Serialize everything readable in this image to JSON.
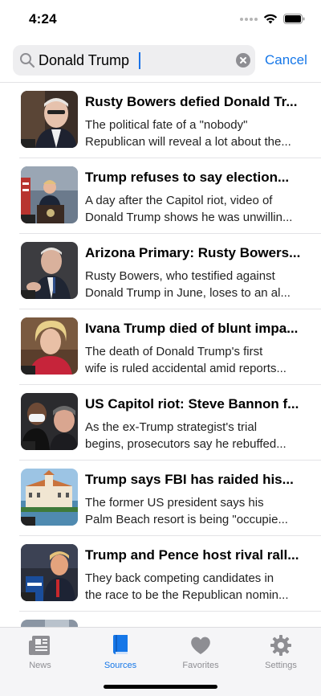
{
  "status": {
    "time": "4:24"
  },
  "search": {
    "query": "Donald Trump",
    "cancel_label": "Cancel"
  },
  "articles": [
    {
      "title": "Rusty Bowers defied Donald Tr...",
      "desc1": "The political fate of a \"nobody\"",
      "desc2": "Republican will reveal a lot about the...",
      "thumb": "man-glasses-portrait"
    },
    {
      "title": " Trump refuses to say election...",
      "desc1": "A day after the Capitol riot, video of",
      "desc2": "Donald Trump shows he was unwillin...",
      "thumb": "podium-press-room"
    },
    {
      "title": "Arizona Primary: Rusty Bowers...",
      "desc1": "Rusty Bowers, who testified against",
      "desc2": "Donald Trump in June, loses to an al...",
      "thumb": "man-testifying"
    },
    {
      "title": "Ivana Trump died of blunt impa...",
      "desc1": "The death of Donald Trump's first",
      "desc2": "wife is ruled accidental amid reports...",
      "thumb": "woman-portrait"
    },
    {
      "title": "US Capitol riot: Steve Bannon f...",
      "desc1": "As the ex-Trump strategist's trial",
      "desc2": "begins, prosecutors say he rebuffed...",
      "thumb": "men-with-mask"
    },
    {
      "title": " Trump says FBI has raided his...",
      "desc1": "The former US president says his",
      "desc2": "Palm Beach resort is being \"occupie...",
      "thumb": "resort-aerial"
    },
    {
      "title": "Trump and Pence host rival rall...",
      "desc1": "They back competing candidates in",
      "desc2": "the race to be the Republican nomin...",
      "thumb": "rally-speaker"
    }
  ],
  "tabs": [
    {
      "label": "News",
      "icon": "newspaper-icon",
      "active": false
    },
    {
      "label": "Sources",
      "icon": "book-icon",
      "active": true
    },
    {
      "label": "Favorites",
      "icon": "heart-icon",
      "active": false
    },
    {
      "label": "Settings",
      "icon": "gear-icon",
      "active": false
    }
  ],
  "colors": {
    "accent": "#1677e8",
    "inactive": "#8e8e93"
  }
}
